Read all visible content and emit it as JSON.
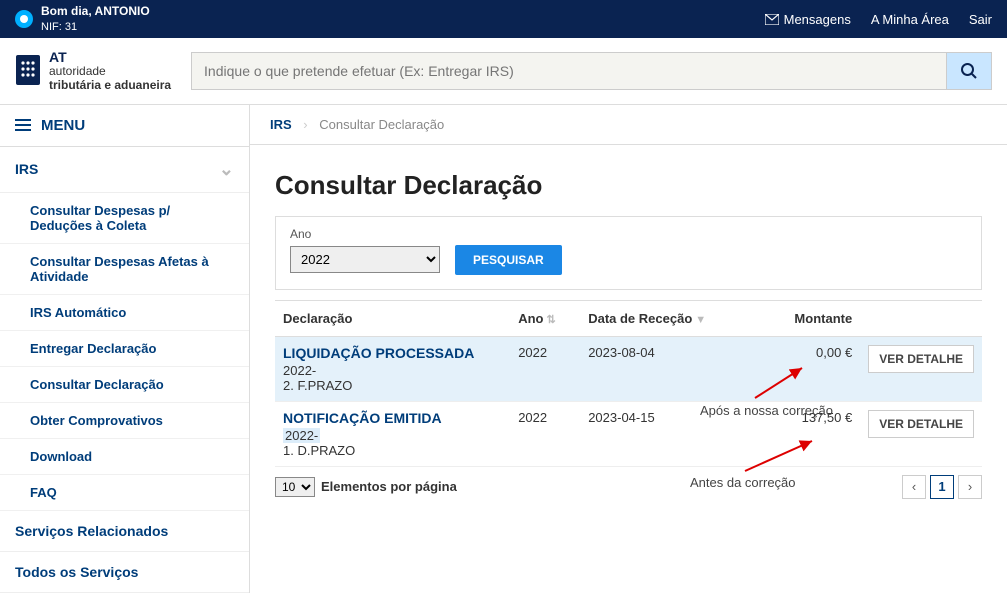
{
  "topbar": {
    "greeting": "Bom dia, ANTONIO",
    "nif_label": "NIF: 31",
    "messages": "Mensagens",
    "my_area": "A Minha Área",
    "logout": "Sair"
  },
  "logo": {
    "at": "AT",
    "line1": "autoridade",
    "line2": "tributária e aduaneira"
  },
  "search": {
    "placeholder": "Indique o que pretende efetuar (Ex: Entregar IRS)"
  },
  "sidebar": {
    "menu_label": "MENU",
    "section_irs": "IRS",
    "items": [
      "Consultar Despesas p/ Deduções à Coleta",
      "Consultar Despesas Afetas à Atividade",
      "IRS Automático",
      "Entregar Declaração",
      "Consultar Declaração",
      "Obter Comprovativos",
      "Download",
      "FAQ"
    ],
    "related": "Serviços Relacionados",
    "all": "Todos os Serviços"
  },
  "breadcrumb": {
    "irs": "IRS",
    "current": "Consultar Declaração"
  },
  "page": {
    "title": "Consultar Declaração"
  },
  "filter": {
    "year_label": "Ano",
    "year_value": "2022",
    "search_btn": "PESQUISAR"
  },
  "table": {
    "headers": {
      "declaracao": "Declaração",
      "ano": "Ano",
      "data": "Data de Receção",
      "montante": "Montante"
    },
    "rows": [
      {
        "status": "LIQUIDAÇÃO PROCESSADA",
        "sub1": "2022-",
        "sub2": "2. F.PRAZO",
        "ano": "2022",
        "data": "2023-08-04",
        "montante": "0,00 €",
        "btn": "VER DETALHE"
      },
      {
        "status": "NOTIFICAÇÃO EMITIDA",
        "sub1": "2022-",
        "sub2": "1. D.PRAZO",
        "ano": "2022",
        "data": "2023-04-15",
        "montante": "137,50 €",
        "btn": "VER DETALHE"
      }
    ],
    "per_page_value": "10",
    "per_page_label": "Elementos por página",
    "page_current": "1"
  },
  "annotations": {
    "after": "Após a nossa correção",
    "before": "Antes da correção"
  }
}
